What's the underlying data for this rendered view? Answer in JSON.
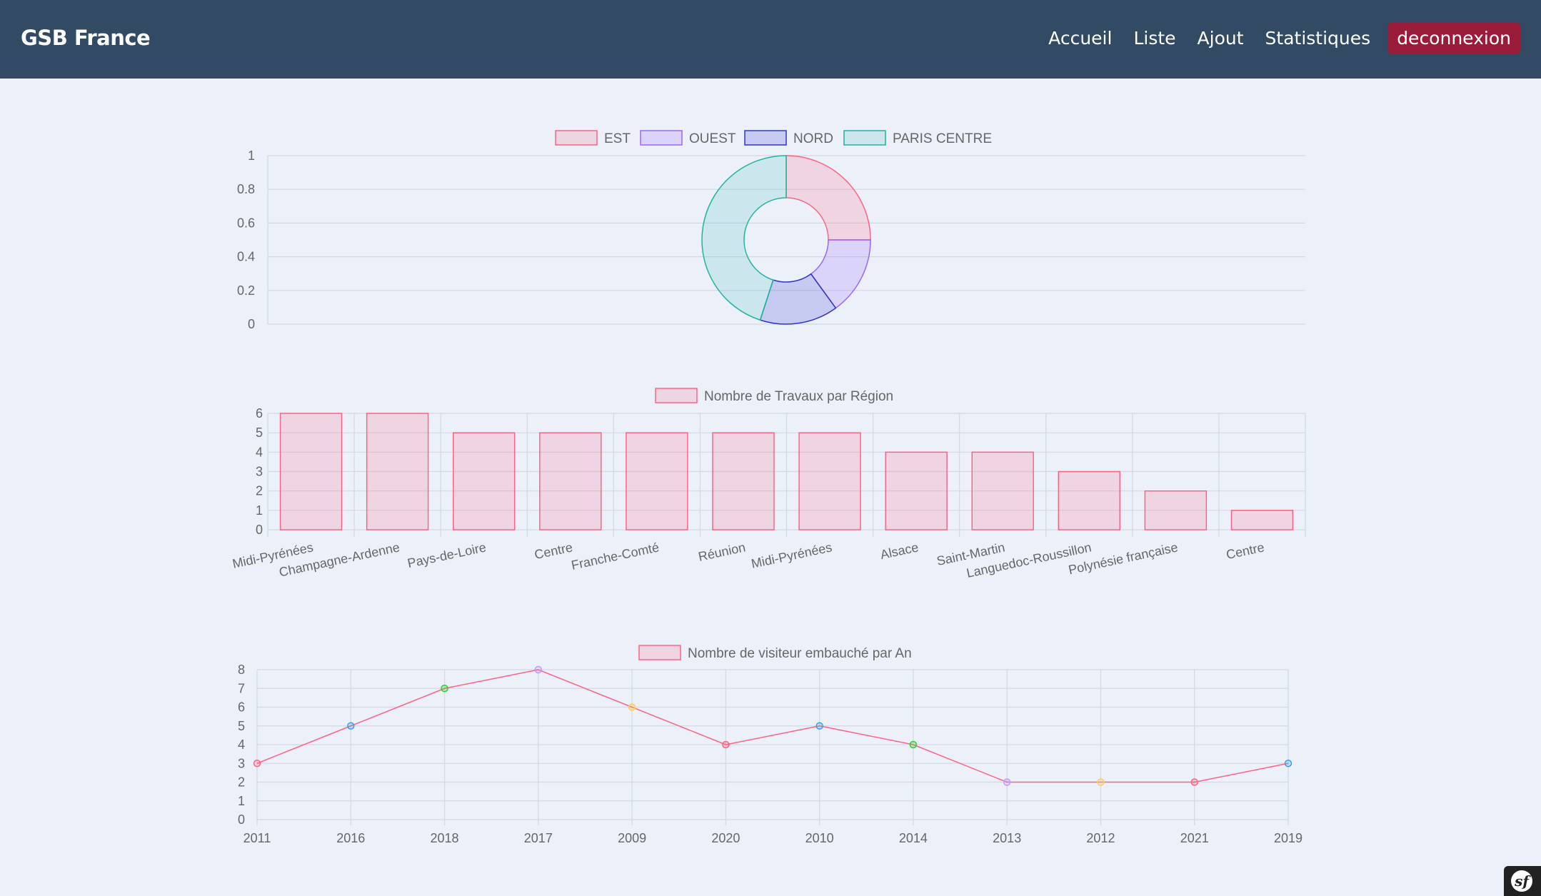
{
  "navbar": {
    "brand": "GSB France",
    "links": [
      "Accueil",
      "Liste",
      "Ajout",
      "Statistiques"
    ],
    "logout": "deconnexion"
  },
  "colors": {
    "navbar_bg": "#324a63",
    "page_bg": "#ebf0f9",
    "logout_bg": "#9b1b3a"
  },
  "chart_data": [
    {
      "type": "pie",
      "variant": "doughnut",
      "legend": [
        "EST",
        "OUEST",
        "NORD",
        "PARIS CENTRE"
      ],
      "values": [
        25,
        15,
        15,
        45
      ],
      "colors": [
        {
          "border": "#ff6384",
          "fill": "rgba(255,99,132,0.2)"
        },
        {
          "border": "#9966ff",
          "fill": "rgba(153,102,255,0.2)"
        },
        {
          "border": "#3333cc",
          "fill": "rgba(51,51,204,0.2)"
        },
        {
          "border": "#22b39c",
          "fill": "rgba(75,192,192,0.2)"
        }
      ],
      "yticks": [
        "0",
        "0.2",
        "0.4",
        "0.6",
        "0.8",
        "1"
      ],
      "legend_position": "top"
    },
    {
      "type": "bar",
      "series": [
        {
          "name": "Nombre de Travaux par Région",
          "values": [
            6,
            6,
            5,
            5,
            5,
            5,
            5,
            4,
            4,
            3,
            2,
            1
          ]
        }
      ],
      "categories": [
        "Midi-Pyrénées",
        "Champagne-Ardenne",
        "Pays-de-Loire",
        "Centre",
        "Franche-Comté",
        "Réunion",
        "Midi-Pyrénées",
        "Alsace",
        "Saint-Martin",
        "Languedoc-Roussillon",
        "Polynésie française",
        "Centre"
      ],
      "ylim": [
        0,
        6
      ],
      "yticks": [
        "0",
        "1",
        "2",
        "3",
        "4",
        "5",
        "6"
      ],
      "color": {
        "border": "#ff6384",
        "fill": "rgba(255,99,132,0.2)"
      },
      "legend_position": "top"
    },
    {
      "type": "line",
      "series": [
        {
          "name": "Nombre de visiteur embauché par An",
          "values": [
            3,
            5,
            7,
            8,
            6,
            4,
            5,
            4,
            2,
            2,
            2,
            3
          ]
        }
      ],
      "categories": [
        "2011",
        "2016",
        "2018",
        "2017",
        "2009",
        "2020",
        "2010",
        "2014",
        "2013",
        "2012",
        "2021",
        "2019"
      ],
      "ylim": [
        0,
        8
      ],
      "yticks": [
        "0",
        "1",
        "2",
        "3",
        "4",
        "5",
        "6",
        "7",
        "8"
      ],
      "line_color": "#ff6384",
      "point_colors": [
        "#ff6384",
        "#36a2eb",
        "#33cc33",
        "#c49bf5",
        "#ffce56",
        "#ff6384",
        "#36a2eb",
        "#33cc33",
        "#c49bf5",
        "#ffce56",
        "#ff6384",
        "#36a2eb"
      ],
      "legend_position": "top"
    }
  ]
}
